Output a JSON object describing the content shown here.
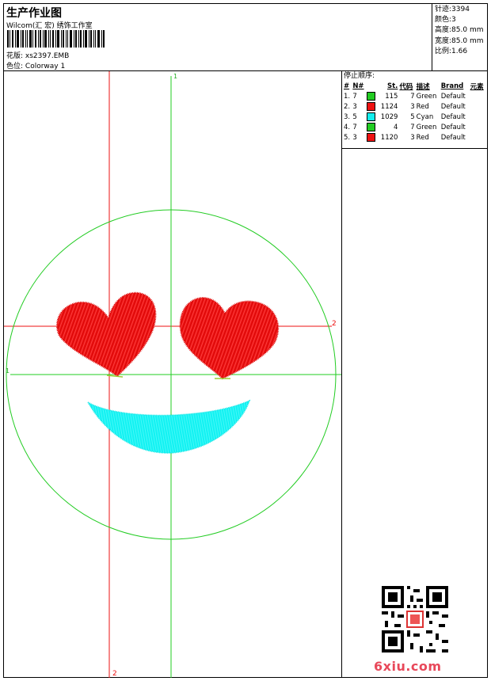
{
  "header": {
    "title": "生产作业图",
    "subtitle": "Wilcom(汇 宏) 绣饰工作室",
    "file_label": "花版:",
    "file_value": "xs2397.EMB",
    "colorway_label": "色位:",
    "colorway_value": "Colorway 1"
  },
  "stats": [
    {
      "label": "针迹:",
      "value": "3394"
    },
    {
      "label": "颜色:",
      "value": "3"
    },
    {
      "label": "高度:",
      "value": "85.0 mm"
    },
    {
      "label": "宽度:",
      "value": "85.0 mm"
    },
    {
      "label": "比例:",
      "value": "1.66"
    }
  ],
  "stop_sequence": {
    "title": "停止顺序:",
    "columns": [
      "#",
      "N#",
      "St.",
      "代码",
      "描述",
      "Brand",
      "元素"
    ],
    "rows": [
      {
        "index": "1.",
        "n": "7",
        "color": "#22cc22",
        "stitches": "115",
        "code": "7",
        "desc": "Green",
        "brand": "Default",
        "element": ""
      },
      {
        "index": "2.",
        "n": "3",
        "color": "#ee1111",
        "stitches": "1124",
        "code": "3",
        "desc": "Red",
        "brand": "Default",
        "element": ""
      },
      {
        "index": "3.",
        "n": "5",
        "color": "#11eeee",
        "stitches": "1029",
        "code": "5",
        "desc": "Cyan",
        "brand": "Default",
        "element": ""
      },
      {
        "index": "4.",
        "n": "7",
        "color": "#22cc22",
        "stitches": "4",
        "code": "7",
        "desc": "Green",
        "brand": "Default",
        "element": ""
      },
      {
        "index": "5.",
        "n": "3",
        "color": "#ee1111",
        "stitches": "1120",
        "code": "3",
        "desc": "Red",
        "brand": "Default",
        "element": ""
      }
    ]
  },
  "axis_markers": {
    "green_vertical": "1",
    "green_horizontal": "1",
    "red_vertical": "2",
    "red_horizontal": "2"
  },
  "colors": {
    "green": "#22cc22",
    "red": "#ee1111",
    "cyan": "#11eeee"
  },
  "watermark": "6xiu.com"
}
